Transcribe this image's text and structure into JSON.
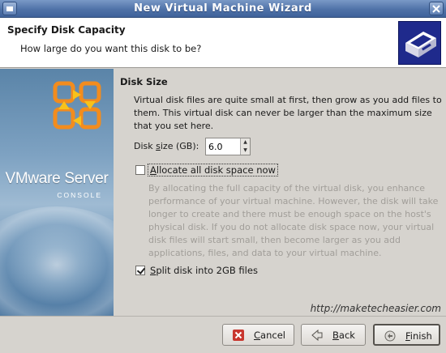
{
  "window": {
    "title": "New Virtual Machine Wizard"
  },
  "header": {
    "title": "Specify Disk Capacity",
    "subtitle": "How large do you want this disk to be?",
    "icon": "hard-disk-icon"
  },
  "banner": {
    "brand": "VMware Server",
    "sub": "CONSOLE",
    "logo": "vmware-logo-icon"
  },
  "section": {
    "title": "Disk Size",
    "description": "Virtual disk files are quite small at first, then grow as you add files to them. This virtual disk can never be larger than the maximum size that you set here."
  },
  "disk_size": {
    "label_prefix": "Disk ",
    "label_mnemonic": "s",
    "label_suffix": "ize (GB):",
    "value": "6.0"
  },
  "allocate": {
    "label_mnemonic": "A",
    "label_rest": "llocate all disk space now",
    "checked": false,
    "description": "By allocating the full capacity of the virtual disk, you enhance performance of your virtual machine. However, the disk will take longer to create and there must be enough space on the host's physical disk. If you do not allocate disk space now, your virtual disk files will start small, then become larger as you add applications, files, and data to your virtual machine."
  },
  "split": {
    "label_mnemonic": "S",
    "label_rest": "plit disk into 2GB files",
    "checked": true
  },
  "watermark": "http://maketecheasier.com",
  "buttons": {
    "cancel": {
      "mnemonic": "C",
      "rest": "ancel",
      "icon": "cancel-x-icon"
    },
    "back": {
      "mnemonic": "B",
      "rest": "ack",
      "icon": "back-arrow-icon"
    },
    "finish": {
      "mnemonic": "F",
      "rest": "inish",
      "icon": "finish-icon"
    }
  },
  "colors": {
    "titlebar": "#4f72a8",
    "dialog_bg": "#d6d3ce",
    "header_icon_bg": "#1f2a8c",
    "logo_orange": "#f28c1e",
    "disabled_text": "#a19e99"
  }
}
